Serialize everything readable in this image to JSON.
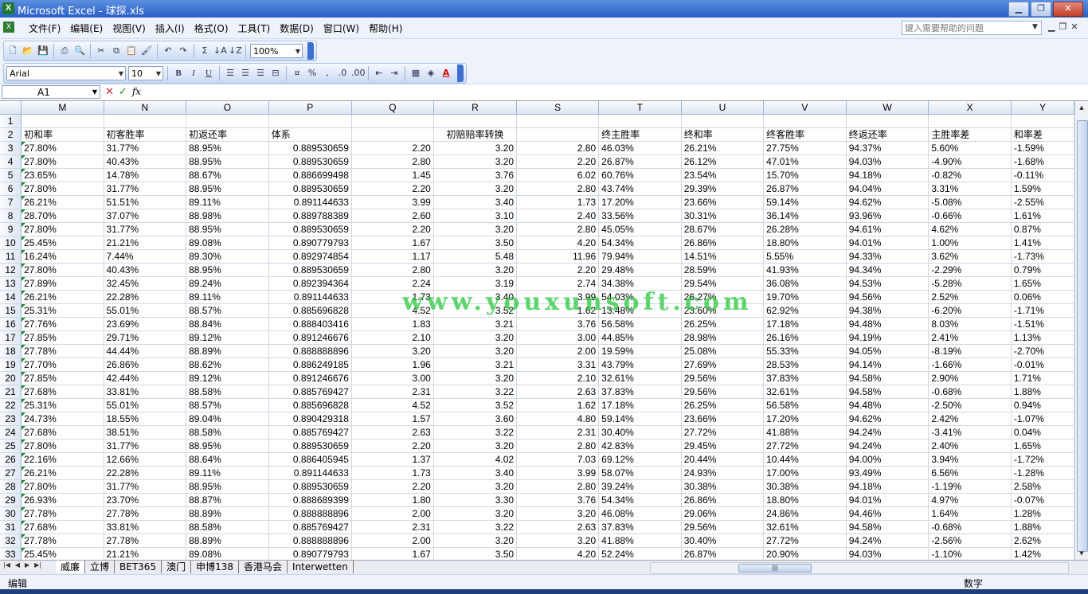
{
  "window": {
    "title": "Microsoft Excel - 球探.xls",
    "app_icon": "excel-icon",
    "buttons": [
      "minimize",
      "restore",
      "close"
    ]
  },
  "menubar": {
    "items": [
      "文件(F)",
      "编辑(E)",
      "视图(V)",
      "插入(I)",
      "格式(O)",
      "工具(T)",
      "数据(D)",
      "窗口(W)",
      "帮助(H)"
    ],
    "help_placeholder": "键入需要帮助的问题"
  },
  "toolbar": {
    "zoom": "100%",
    "font_name": "Arial",
    "font_size": "10",
    "bold": "B",
    "italic": "I",
    "underline": "U",
    "font_color": "A",
    "sum": "Σ"
  },
  "formula_bar": {
    "name_box": "A1",
    "fx": "fx"
  },
  "sheet": {
    "columns": [
      "M",
      "N",
      "O",
      "P",
      "Q",
      "R",
      "S",
      "T",
      "U",
      "V",
      "W",
      "X",
      "Y"
    ],
    "header_row": [
      "初和率",
      "初客胜率",
      "初返还率",
      "体系",
      "",
      "初赔赔率转换",
      "",
      "终主胜率",
      "终和率",
      "终客胜率",
      "终返还率",
      "主胜率差",
      "和率差"
    ],
    "rows": [
      [
        "27.80%",
        "31.77%",
        "88.95%",
        "0.889530659",
        "2.20",
        "3.20",
        "2.80",
        "46.03%",
        "26.21%",
        "27.75%",
        "94.37%",
        "5.60%",
        "-1.59%"
      ],
      [
        "27.80%",
        "40.43%",
        "88.95%",
        "0.889530659",
        "2.80",
        "3.20",
        "2.20",
        "26.87%",
        "26.12%",
        "47.01%",
        "94.03%",
        "-4.90%",
        "-1.68%"
      ],
      [
        "23.65%",
        "14.78%",
        "88.67%",
        "0.886699498",
        "1.45",
        "3.76",
        "6.02",
        "60.76%",
        "23.54%",
        "15.70%",
        "94.18%",
        "-0.82%",
        "-0.11%"
      ],
      [
        "27.80%",
        "31.77%",
        "88.95%",
        "0.889530659",
        "2.20",
        "3.20",
        "2.80",
        "43.74%",
        "29.39%",
        "26.87%",
        "94.04%",
        "3.31%",
        "1.59%"
      ],
      [
        "26.21%",
        "51.51%",
        "89.11%",
        "0.891144633",
        "3.99",
        "3.40",
        "1.73",
        "17.20%",
        "23.66%",
        "59.14%",
        "94.62%",
        "-5.08%",
        "-2.55%"
      ],
      [
        "28.70%",
        "37.07%",
        "88.98%",
        "0.889788389",
        "2.60",
        "3.10",
        "2.40",
        "33.56%",
        "30.31%",
        "36.14%",
        "93.96%",
        "-0.66%",
        "1.61%"
      ],
      [
        "27.80%",
        "31.77%",
        "88.95%",
        "0.889530659",
        "2.20",
        "3.20",
        "2.80",
        "45.05%",
        "28.67%",
        "26.28%",
        "94.61%",
        "4.62%",
        "0.87%"
      ],
      [
        "25.45%",
        "21.21%",
        "89.08%",
        "0.890779793",
        "1.67",
        "3.50",
        "4.20",
        "54.34%",
        "26.86%",
        "18.80%",
        "94.01%",
        "1.00%",
        "1.41%"
      ],
      [
        "16.24%",
        "7.44%",
        "89.30%",
        "0.892974854",
        "1.17",
        "5.48",
        "11.96",
        "79.94%",
        "14.51%",
        "5.55%",
        "94.33%",
        "3.62%",
        "-1.73%"
      ],
      [
        "27.80%",
        "40.43%",
        "88.95%",
        "0.889530659",
        "2.80",
        "3.20",
        "2.20",
        "29.48%",
        "28.59%",
        "41.93%",
        "94.34%",
        "-2.29%",
        "0.79%"
      ],
      [
        "27.89%",
        "32.45%",
        "89.24%",
        "0.892394364",
        "2.24",
        "3.19",
        "2.74",
        "34.38%",
        "29.54%",
        "36.08%",
        "94.53%",
        "-5.28%",
        "1.65%"
      ],
      [
        "26.21%",
        "22.28%",
        "89.11%",
        "0.891144633",
        "1.73",
        "3.40",
        "3.99",
        "54.03%",
        "26.27%",
        "19.70%",
        "94.56%",
        "2.52%",
        "0.06%"
      ],
      [
        "25.31%",
        "55.01%",
        "88.57%",
        "0.885696828",
        "4.52",
        "3.52",
        "1.62",
        "13.48%",
        "23.60%",
        "62.92%",
        "94.38%",
        "-6.20%",
        "-1.71%"
      ],
      [
        "27.76%",
        "23.69%",
        "88.84%",
        "0.888403416",
        "1.83",
        "3.21",
        "3.76",
        "56.58%",
        "26.25%",
        "17.18%",
        "94.48%",
        "8.03%",
        "-1.51%"
      ],
      [
        "27.85%",
        "29.71%",
        "89.12%",
        "0.891246676",
        "2.10",
        "3.20",
        "3.00",
        "44.85%",
        "28.98%",
        "26.16%",
        "94.19%",
        "2.41%",
        "1.13%"
      ],
      [
        "27.78%",
        "44.44%",
        "88.89%",
        "0.888888896",
        "3.20",
        "3.20",
        "2.00",
        "19.59%",
        "25.08%",
        "55.33%",
        "94.05%",
        "-8.19%",
        "-2.70%"
      ],
      [
        "27.70%",
        "26.86%",
        "88.62%",
        "0.886249185",
        "1.96",
        "3.21",
        "3.31",
        "43.79%",
        "27.69%",
        "28.53%",
        "94.14%",
        "-1.66%",
        "-0.01%"
      ],
      [
        "27.85%",
        "42.44%",
        "89.12%",
        "0.891246676",
        "3.00",
        "3.20",
        "2.10",
        "32.61%",
        "29.56%",
        "37.83%",
        "94.58%",
        "2.90%",
        "1.71%"
      ],
      [
        "27.68%",
        "33.81%",
        "88.58%",
        "0.885769427",
        "2.31",
        "3.22",
        "2.63",
        "37.83%",
        "29.56%",
        "32.61%",
        "94.58%",
        "-0.68%",
        "1.88%"
      ],
      [
        "25.31%",
        "55.01%",
        "88.57%",
        "0.885696828",
        "4.52",
        "3.52",
        "1.62",
        "17.18%",
        "26.25%",
        "56.58%",
        "94.48%",
        "-2.50%",
        "0.94%"
      ],
      [
        "24.73%",
        "18.55%",
        "89.04%",
        "0.890429318",
        "1.57",
        "3.60",
        "4.80",
        "59.14%",
        "23.66%",
        "17.20%",
        "94.62%",
        "2.42%",
        "-1.07%"
      ],
      [
        "27.68%",
        "38.51%",
        "88.58%",
        "0.885769427",
        "2.63",
        "3.22",
        "2.31",
        "30.40%",
        "27.72%",
        "41.88%",
        "94.24%",
        "-3.41%",
        "0.04%"
      ],
      [
        "27.80%",
        "31.77%",
        "88.95%",
        "0.889530659",
        "2.20",
        "3.20",
        "2.80",
        "42.83%",
        "29.45%",
        "27.72%",
        "94.24%",
        "2.40%",
        "1.65%"
      ],
      [
        "22.16%",
        "12.66%",
        "88.64%",
        "0.886405945",
        "1.37",
        "4.02",
        "7.03",
        "69.12%",
        "20.44%",
        "10.44%",
        "94.00%",
        "3.94%",
        "-1.72%"
      ],
      [
        "26.21%",
        "22.28%",
        "89.11%",
        "0.891144633",
        "1.73",
        "3.40",
        "3.99",
        "58.07%",
        "24.93%",
        "17.00%",
        "93.49%",
        "6.56%",
        "-1.28%"
      ],
      [
        "27.80%",
        "31.77%",
        "88.95%",
        "0.889530659",
        "2.20",
        "3.20",
        "2.80",
        "39.24%",
        "30.38%",
        "30.38%",
        "94.18%",
        "-1.19%",
        "2.58%"
      ],
      [
        "26.93%",
        "23.70%",
        "88.87%",
        "0.888689399",
        "1.80",
        "3.30",
        "3.76",
        "54.34%",
        "26.86%",
        "18.80%",
        "94.01%",
        "4.97%",
        "-0.07%"
      ],
      [
        "27.78%",
        "27.78%",
        "88.89%",
        "0.888888896",
        "2.00",
        "3.20",
        "3.20",
        "46.08%",
        "29.06%",
        "24.86%",
        "94.46%",
        "1.64%",
        "1.28%"
      ],
      [
        "27.68%",
        "33.81%",
        "88.58%",
        "0.885769427",
        "2.31",
        "3.22",
        "2.63",
        "37.83%",
        "29.56%",
        "32.61%",
        "94.58%",
        "-0.68%",
        "1.88%"
      ],
      [
        "27.78%",
        "27.78%",
        "88.89%",
        "0.888888896",
        "2.00",
        "3.20",
        "3.20",
        "41.88%",
        "30.40%",
        "27.72%",
        "94.24%",
        "-2.56%",
        "2.62%"
      ],
      [
        "25.45%",
        "21.21%",
        "89.08%",
        "0.890779793",
        "1.67",
        "3.50",
        "4.20",
        "52.24%",
        "26.87%",
        "20.90%",
        "94.03%",
        "-1.10%",
        "1.42%"
      ]
    ]
  },
  "watermark": "www.youxunsoft.com",
  "sheet_tabs": [
    "威廉",
    "立博",
    "BET365",
    "澳门",
    "申博138",
    "香港马会",
    "Interwetten"
  ],
  "status": {
    "mode": "编辑",
    "num": "数字"
  }
}
